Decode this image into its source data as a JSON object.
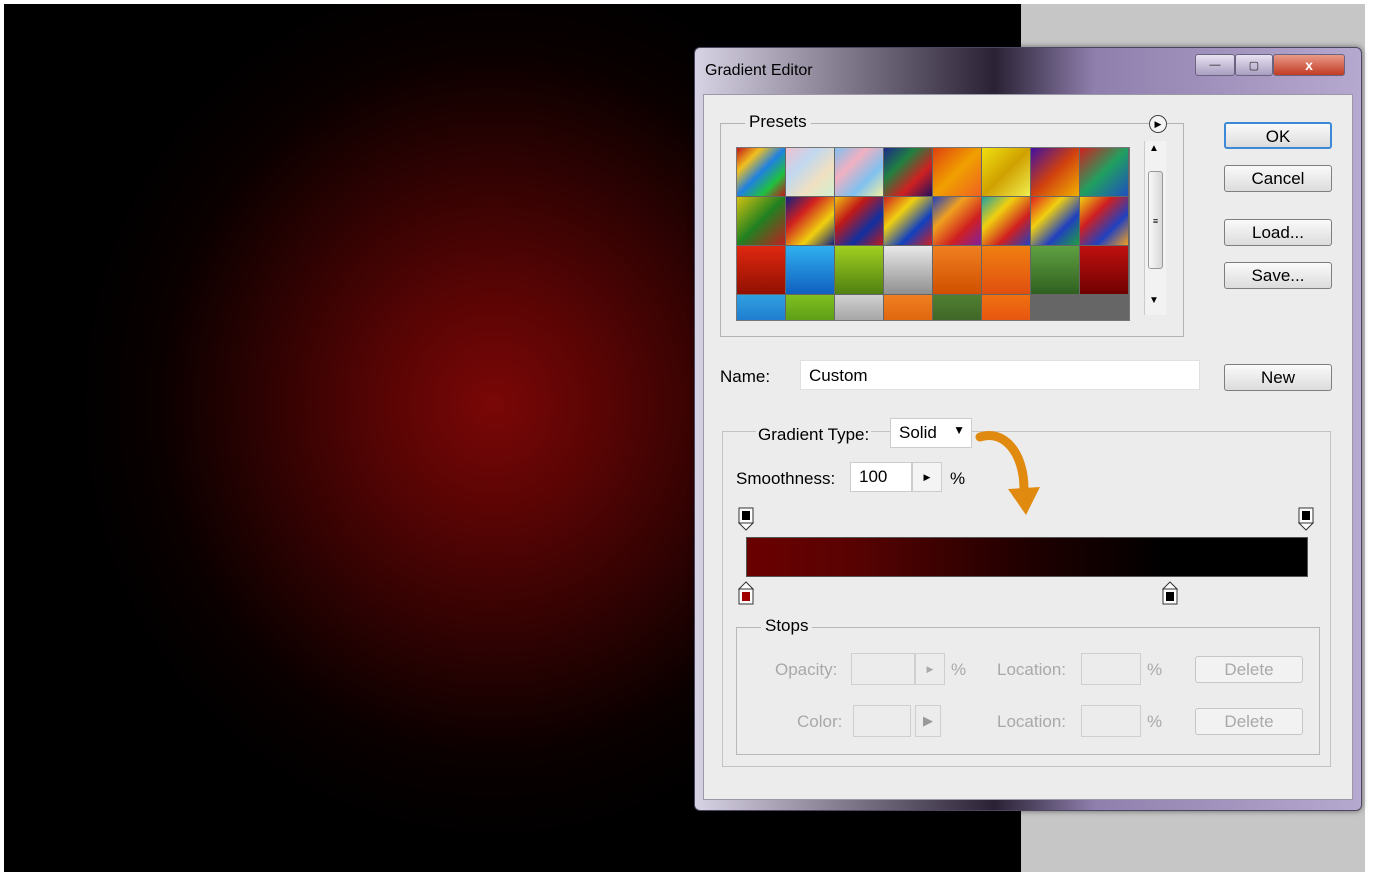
{
  "window": {
    "title": "Gradient Editor",
    "minimize_label": "—",
    "maximize_label": "▢",
    "close_label": "x"
  },
  "presets": {
    "legend": "Presets",
    "menu_icon": "play-circle-icon",
    "swatches": [
      "linear-gradient(135deg,#c01818,#f0c020,#2080e0,#20c040,#c01818)",
      "linear-gradient(135deg,#f0c0d0,#c0d8f0,#f0e0c0,#d0f0d0)",
      "linear-gradient(135deg,#80c0f0,#f0b0c0,#80c0f0,#f0f0a0)",
      "linear-gradient(135deg,#1a2a8a,#208040,#d02020,#201060)",
      "linear-gradient(135deg,#e04010,#f0a000,#f06020)",
      "linear-gradient(135deg,#f0e010,#d0a000,#f0f050)",
      "linear-gradient(135deg,#4010a0,#d04010,#f0b000)",
      "linear-gradient(135deg,#d02020,#20a060,#2050c0)",
      "linear-gradient(135deg,#d0c010,#208020,#c02020)",
      "linear-gradient(135deg,#102080,#d02020,#f0d010,#102080)",
      "linear-gradient(135deg,#f0c010,#c01818,#1030a0,#c01818)",
      "linear-gradient(135deg,#d02020,#f0d010,#1040c0,#d02020)",
      "linear-gradient(135deg,#2040c0,#f0a020,#d02020,#8020a0)",
      "linear-gradient(135deg,#20a0a0,#f0d010,#d02020,#2040c0)",
      "linear-gradient(135deg,#e02020,#f0d010,#2040c0,#20a040)",
      "linear-gradient(135deg,#f0d010,#d02020,#2040c0,#f0a020)",
      "linear-gradient(180deg,#e02810,#901000)",
      "linear-gradient(180deg,#30b0f0,#1060c0)",
      "linear-gradient(180deg,#a0d020,#508010)",
      "linear-gradient(180deg,#e8e8e8,#909090)",
      "linear-gradient(180deg,#f08020,#d05000)",
      "linear-gradient(180deg,#f08010,#e05010)",
      "linear-gradient(180deg,#60a040,#306020)",
      "linear-gradient(180deg,#c01010,#700000)",
      "linear-gradient(180deg,#30a0e0,#1060c0)",
      "linear-gradient(180deg,#80c020,#408010)",
      "linear-gradient(180deg,#d0d0d0,#808080)",
      "linear-gradient(180deg,#f08020,#d05000)",
      "linear-gradient(180deg,#508030,#305020)",
      "linear-gradient(180deg,#f07010,#e04010)"
    ]
  },
  "buttons": {
    "ok": "OK",
    "cancel": "Cancel",
    "load": "Load...",
    "save": "Save...",
    "new": "New"
  },
  "name": {
    "label": "Name:",
    "value": "Custom"
  },
  "gradient": {
    "type_label": "Gradient Type:",
    "type_value": "Solid",
    "smoothness_label": "Smoothness:",
    "smoothness_value": "100",
    "smoothness_unit": "%",
    "stops": {
      "left_color": "#6a0000",
      "right_color": "#000000"
    }
  },
  "stops_panel": {
    "legend": "Stops",
    "opacity_label": "Opacity:",
    "location_label": "Location:",
    "color_label": "Color:",
    "percent": "%",
    "delete_label": "Delete"
  }
}
